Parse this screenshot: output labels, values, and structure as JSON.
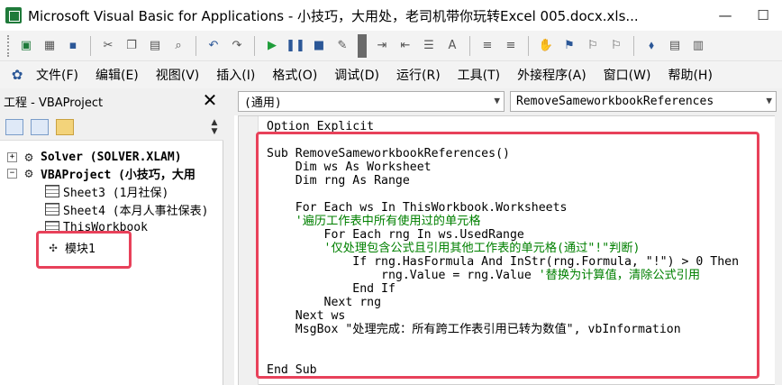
{
  "window": {
    "title": "Microsoft Visual Basic for Applications - 小技巧，大用处，老司机带你玩转Excel 005.docx.xls...",
    "minimize_glyph": "—",
    "maximize_glyph": "☐"
  },
  "menu": {
    "items": [
      "文件(F)",
      "编辑(E)",
      "视图(V)",
      "插入(I)",
      "格式(O)",
      "调试(D)",
      "运行(R)",
      "工具(T)",
      "外接程序(A)",
      "窗口(W)",
      "帮助(H)"
    ]
  },
  "project": {
    "title": "工程 - VBAProject",
    "close_glyph": "✕",
    "tree": [
      {
        "label": "Solver (SOLVER.XLAM)",
        "bold": true,
        "type": "project",
        "toggle": "+"
      },
      {
        "label": "VBAProject (小技巧，大用",
        "bold": true,
        "type": "project",
        "toggle": "−"
      },
      {
        "label": "Sheet3 (1月社保)",
        "type": "sheet"
      },
      {
        "label": "Sheet4 (本月人事社保表)",
        "type": "sheet"
      },
      {
        "label": "ThisWorkbook",
        "type": "sheet"
      },
      {
        "label": "模块1",
        "type": "module"
      }
    ]
  },
  "code": {
    "object_combo": "(通用)",
    "procedure_combo": "RemoveSameworkbookReferences",
    "lines": [
      {
        "text": "Option Explicit",
        "kind": "kw"
      },
      {
        "text": "",
        "kind": "plain"
      },
      {
        "text": "Sub RemoveSameworkbookReferences()",
        "kind": "plain"
      },
      {
        "text": "    Dim ws As Worksheet",
        "kind": "plain"
      },
      {
        "text": "    Dim rng As Range",
        "kind": "plain"
      },
      {
        "text": "",
        "kind": "plain"
      },
      {
        "text": "    For Each ws In ThisWorkbook.Worksheets",
        "kind": "plain"
      },
      {
        "text": "    '遍历工作表中所有使用过的单元格",
        "kind": "comment"
      },
      {
        "text": "        For Each rng In ws.UsedRange",
        "kind": "plain"
      },
      {
        "text": "        '仅处理包含公式且引用其他工作表的单元格(通过\"!\"判断)",
        "kind": "comment"
      },
      {
        "text": "            If rng.HasFormula And InStr(rng.Formula, \"!\") > 0 Then",
        "kind": "plain"
      },
      {
        "text": "                rng.Value = rng.Value '替换为计算值，清除公式引用",
        "kind": "mixed"
      },
      {
        "text": "            End If",
        "kind": "plain"
      },
      {
        "text": "        Next rng",
        "kind": "plain"
      },
      {
        "text": "    Next ws",
        "kind": "plain"
      },
      {
        "text": "    MsgBox \"处理完成：所有跨工作表引用已转为数值\", vbInformation",
        "kind": "plain"
      },
      {
        "text": "",
        "kind": "plain"
      },
      {
        "text": "",
        "kind": "plain"
      },
      {
        "text": "End Sub",
        "kind": "plain"
      }
    ]
  },
  "colors": {
    "highlight_box": "#e8415a",
    "comment": "#008000",
    "keyword": "#00008b"
  }
}
